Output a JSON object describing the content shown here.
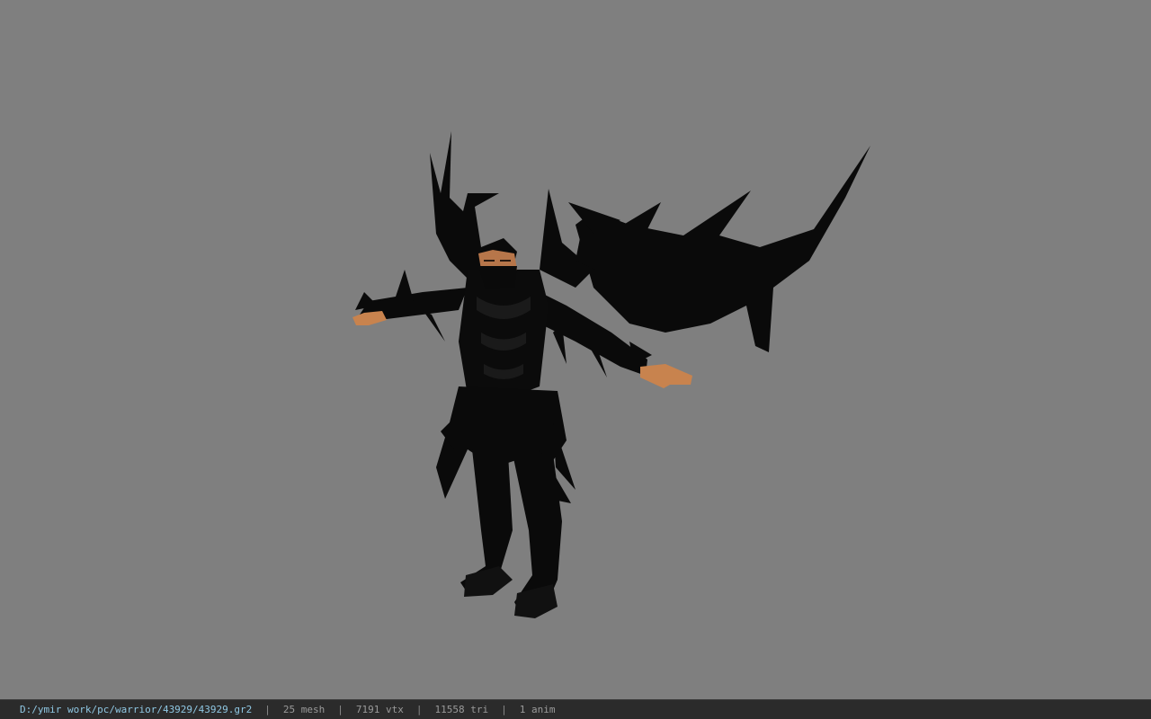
{
  "viewport": {
    "background": "#7f7f7f",
    "model": "armored-warrior-character"
  },
  "status_bar": {
    "file_path": "D:/ymir work/pc/warrior/43929/43929.gr2",
    "separator": "|",
    "mesh_count": "25 mesh",
    "vertex_count": "7191 vtx",
    "triangle_count": "11558 tri",
    "animation_count": "1 anim",
    "path_color": "#8fc7e3",
    "bar_color": "#2b2b2b"
  }
}
